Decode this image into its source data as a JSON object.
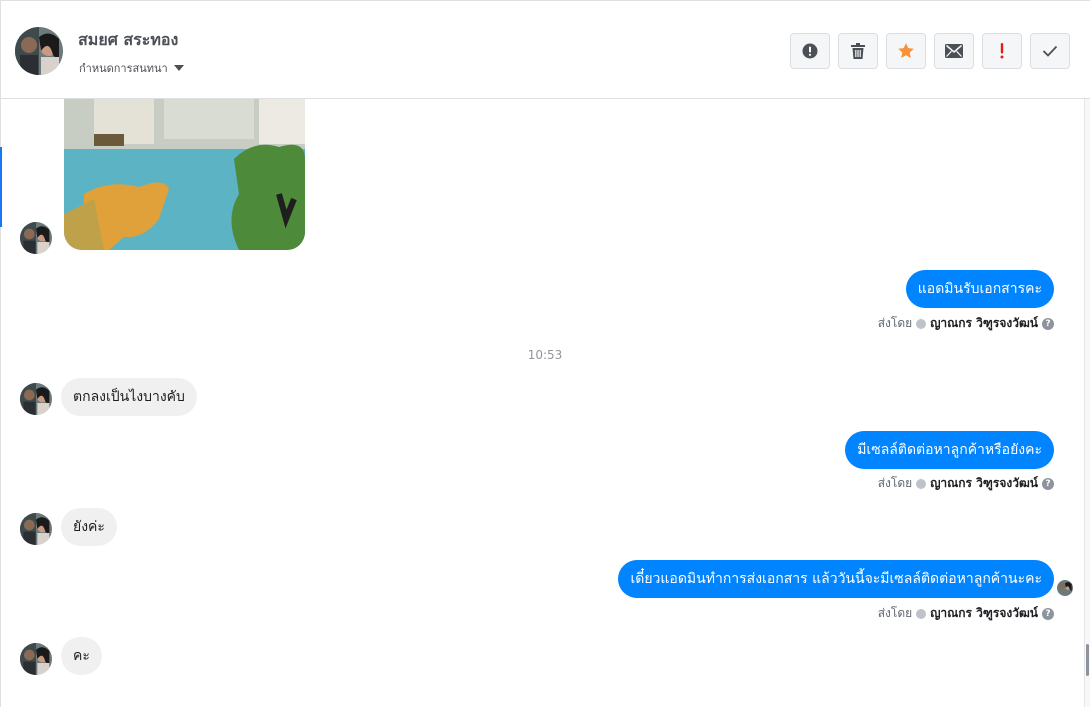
{
  "conversation": {
    "contact_name": "สมยศ สระทอง",
    "assign_label": "กำหนดการสนทนา"
  },
  "toolbar": {
    "buttons": [
      {
        "name": "report-button",
        "icon": "alert-circle-icon"
      },
      {
        "name": "delete-button",
        "icon": "trash-icon"
      },
      {
        "name": "star-button",
        "icon": "star-icon",
        "color": "#f7923b"
      },
      {
        "name": "mark-unread-button",
        "icon": "envelope-icon"
      },
      {
        "name": "important-button",
        "icon": "exclamation-icon",
        "color": "#e02020"
      },
      {
        "name": "mark-done-button",
        "icon": "checkmark-icon"
      }
    ]
  },
  "messages": {
    "out_1": "แอดมินรับเอกสารคะ",
    "in_1": "ตกลงเป็นไงบางคับ",
    "out_2": "มีเซลล์ติดต่อหาลูกค้าหรือยังคะ",
    "in_2": "ยังค่ะ",
    "out_3": "เดี๋ยวแอดมินทำการส่งเอกสาร แล้ววันนี้จะมีเซลล์ติดต่อหาลูกค้านะคะ",
    "in_3": "คะ"
  },
  "sent_by": {
    "label": "ส่งโดย",
    "agent": "ญาณกร วิฑูรจงวัฒน์"
  },
  "timestamp": "10:53",
  "colors": {
    "outgoing_bubble": "#0084ff",
    "incoming_bubble": "#f1f0f0",
    "accent": "#1877f2"
  }
}
